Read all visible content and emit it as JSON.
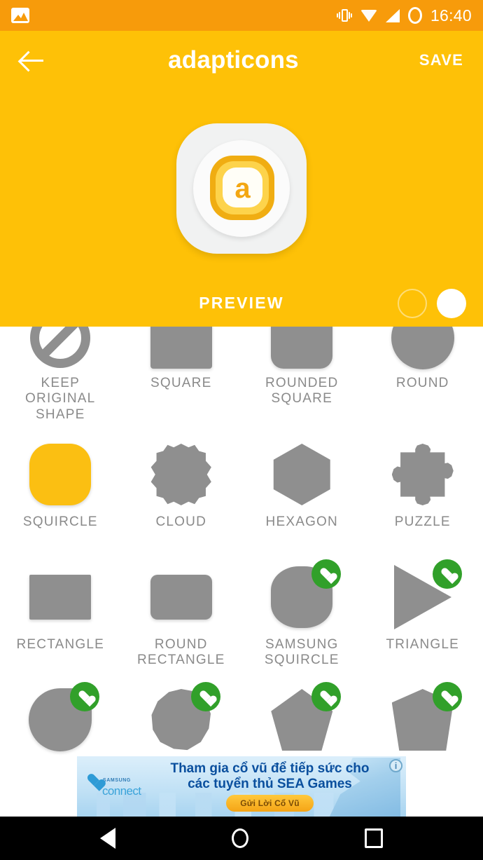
{
  "status_bar": {
    "left_icon": "photo-icon",
    "icons": [
      "vibrate-icon",
      "wifi-icon",
      "signal-icon",
      "battery-icon"
    ],
    "time": "16:40",
    "bg_color": "#F79B0B"
  },
  "toolbar": {
    "back_icon": "back-arrow-icon",
    "title": "adapticons",
    "save_label": "SAVE",
    "bg_color": "#FEC107"
  },
  "preview": {
    "label": "PREVIEW",
    "logo_letter": "a",
    "icon_shape": "squircle-with-circle",
    "page_dots": [
      {
        "state": "empty"
      },
      {
        "state": "filled"
      }
    ]
  },
  "shapes": {
    "selected": "SQUIRCLE",
    "items": [
      {
        "label": "KEEP ORIGINAL SHAPE",
        "shape": "no-shape",
        "selected": false,
        "premium": false
      },
      {
        "label": "SQUARE",
        "shape": "square",
        "selected": false,
        "premium": false
      },
      {
        "label": "ROUNDED SQUARE",
        "shape": "rounded-square",
        "selected": false,
        "premium": false
      },
      {
        "label": "ROUND",
        "shape": "round",
        "selected": false,
        "premium": false
      },
      {
        "label": "SQUIRCLE",
        "shape": "squircle",
        "selected": true,
        "premium": false
      },
      {
        "label": "CLOUD",
        "shape": "cloud",
        "selected": false,
        "premium": false
      },
      {
        "label": "HEXAGON",
        "shape": "hexagon",
        "selected": false,
        "premium": false
      },
      {
        "label": "PUZZLE",
        "shape": "puzzle",
        "selected": false,
        "premium": false
      },
      {
        "label": "RECTANGLE",
        "shape": "rectangle",
        "selected": false,
        "premium": false
      },
      {
        "label": "ROUND RECTANGLE",
        "shape": "round-rectangle",
        "selected": false,
        "premium": false
      },
      {
        "label": "SAMSUNG SQUIRCLE",
        "shape": "samsung-squircle",
        "selected": false,
        "premium": true
      },
      {
        "label": "TRIANGLE",
        "shape": "triangle",
        "selected": false,
        "premium": true
      },
      {
        "label": "",
        "shape": "teardrop",
        "selected": false,
        "premium": true
      },
      {
        "label": "",
        "shape": "blob",
        "selected": false,
        "premium": true
      },
      {
        "label": "",
        "shape": "pentagon",
        "selected": false,
        "premium": true
      },
      {
        "label": "",
        "shape": "pentagon-tall",
        "selected": false,
        "premium": true
      }
    ],
    "premium_badge_icon": "heart-icon",
    "premium_badge_color": "#31A02A",
    "shape_color": "#8F8F8F",
    "selected_color": "#FBBF12"
  },
  "ad": {
    "brand_top": "SAMSUNG",
    "brand_main": "connect",
    "logo_icon": "heart-icon",
    "line1": "Tham gia cổ vũ để tiếp sức cho",
    "line2": "các tuyển thủ SEA Games",
    "cta_label": "Gửi Lời Cổ Vũ",
    "info_label": "i"
  },
  "nav_bar": {
    "back": "back-triangle-icon",
    "home": "home-circle-icon",
    "recents": "recents-square-icon"
  }
}
